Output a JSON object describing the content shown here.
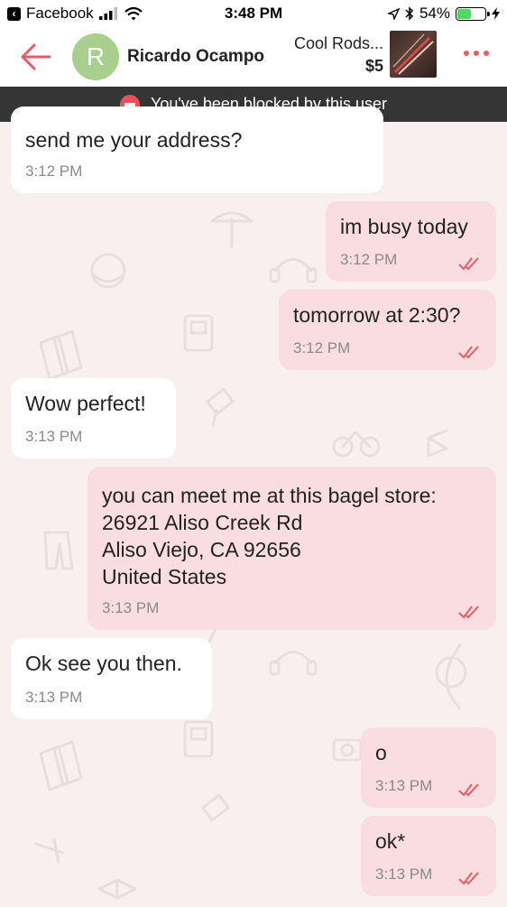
{
  "status_bar": {
    "back_app": "Facebook",
    "time": "3:48 PM",
    "battery": "54%",
    "battery_level": 0.54
  },
  "header": {
    "avatar_initial": "R",
    "contact_name": "Ricardo Ocampo",
    "listing_title": "Cool Rods...",
    "listing_price": "$5"
  },
  "banner": {
    "text": "You've been blocked by this user"
  },
  "messages": [
    {
      "direction": "in",
      "text": "send me your address?",
      "time": "3:12 PM"
    },
    {
      "direction": "out",
      "text": "im busy today",
      "time": "3:12 PM",
      "read": true
    },
    {
      "direction": "out",
      "text": "tomorrow at 2:30?",
      "time": "3:12 PM",
      "read": true
    },
    {
      "direction": "in",
      "text": "Wow perfect!",
      "time": "3:13 PM"
    },
    {
      "direction": "out",
      "text": "you can meet me at this bagel store:\n26921 Aliso Creek Rd\nAliso Viejo, CA  92656\nUnited States",
      "time": "3:13 PM",
      "read": true
    },
    {
      "direction": "in",
      "text": "Ok see you then.",
      "time": "3:13 PM"
    },
    {
      "direction": "out",
      "text": "o",
      "time": "3:13 PM",
      "read": true
    },
    {
      "direction": "out",
      "text": "ok*",
      "time": "3:13 PM",
      "read": true
    }
  ],
  "colors": {
    "accent": "#e85a64",
    "outgoing_bubble": "#f9dde0",
    "incoming_bubble": "#ffffff",
    "banner_bg": "#353535",
    "chat_bg": "#f7f0ef"
  }
}
